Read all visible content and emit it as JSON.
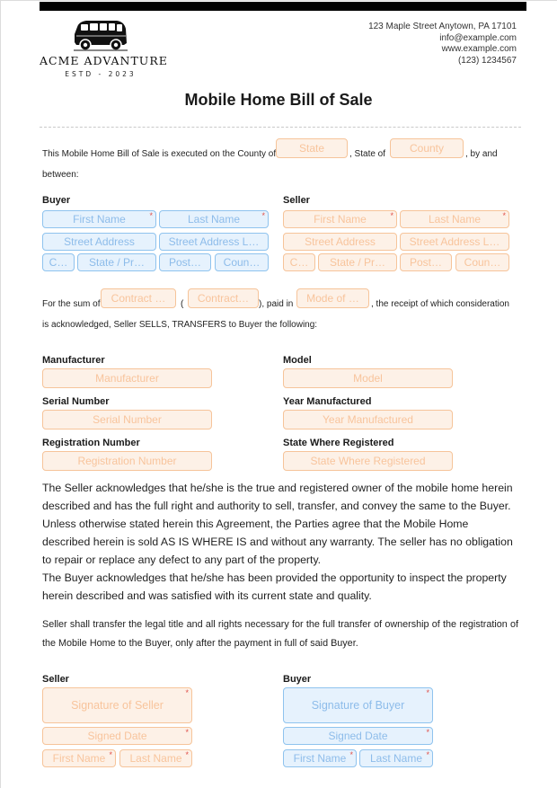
{
  "header": {
    "logo": {
      "name": "ACME ADVANTURE",
      "established": "ESTD - 2023",
      "icon": "van-icon"
    },
    "contact": {
      "address": "123 Maple Street Anytown, PA 17101",
      "email": "info@example.com",
      "website": "www.example.com",
      "phone": "(123) 1234567"
    }
  },
  "document": {
    "title": "Mobile Home Bill of Sale",
    "intro": {
      "text_before": "This Mobile Home Bill of Sale is executed on the County of",
      "field1_placeholder": "State",
      "text_middle": ", State of",
      "field2_placeholder": "County",
      "text_after": ", by and",
      "text_line2": "between:"
    },
    "buyer": {
      "label": "Buyer",
      "fields": {
        "first_name": "First Name",
        "last_name": "Last Name",
        "street_address": "Street Address",
        "street_address_line2": "Street Address L…",
        "city": "C…",
        "state": "State / Pr…",
        "postal": "Post…",
        "country": "Coun…"
      }
    },
    "seller": {
      "label": "Seller",
      "fields": {
        "first_name": "First Name",
        "last_name": "Last Name",
        "street_address": "Street Address",
        "street_address_line2": "Street Address L…",
        "city": "C…",
        "state": "State / Pr…",
        "postal": "Post…",
        "country": "Coun…"
      }
    },
    "sum": {
      "text_before": "For the sum of",
      "field1_placeholder": "Contract …",
      "paren_open": "(",
      "field2_placeholder": "Contract…",
      "text_paid_in": "), paid in",
      "field3_placeholder": "Mode of …",
      "text_after": ", the receipt of which consideration",
      "text_line2": "is acknowledged, Seller SELLS, TRANSFERS to Buyer the following:"
    },
    "property": {
      "manufacturer": {
        "label": "Manufacturer",
        "placeholder": "Manufacturer"
      },
      "model": {
        "label": "Model",
        "placeholder": "Model"
      },
      "serial_number": {
        "label": "Serial Number",
        "placeholder": "Serial Number"
      },
      "year_manufactured": {
        "label": "Year Manufactured",
        "placeholder": "Year Manufactured"
      },
      "registration_number": {
        "label": "Registration Number",
        "placeholder": "Registration Number"
      },
      "state_registered": {
        "label": "State Where Registered",
        "placeholder": "State Where Registered"
      }
    },
    "acknowledgement": {
      "lines": [
        "The Seller acknowledges that he/she is the true and registered owner of the mobile home herein",
        "described and has the full right and authority to sell, transfer, and convey the same to the Buyer.",
        "Unless otherwise stated herein this Agreement, the Parties agree that the Mobile Home",
        "described herein is sold AS IS WHERE IS and without any warranty. The seller has no obligation",
        "to repair or replace any defect to any part of the property.",
        "The Buyer acknowledges that he/she has been provided the opportunity to inspect the property",
        "herein described and was satisfied with its current state and quality."
      ]
    },
    "transfer_clause": "Seller shall transfer the legal title and all rights necessary for the full transfer of ownership of the registration of the Mobile Home to the Buyer, only after the payment in full of said Buyer.",
    "signatures": {
      "seller": {
        "label": "Seller",
        "signature": "Signature of Seller",
        "signed_date": "Signed Date",
        "first_name": "First Name",
        "last_name": "Last Name"
      },
      "buyer": {
        "label": "Buyer",
        "signature": "Signature of Buyer",
        "signed_date": "Signed Date",
        "first_name": "First Name",
        "last_name": "Last Name"
      }
    }
  },
  "colors": {
    "orange_field_bg": "#fdf1e7",
    "orange_field_border": "#f6c49a",
    "blue_field_bg": "#e6f2fd",
    "blue_field_border": "#8fc3ee",
    "required_marker": "#e0504a"
  }
}
